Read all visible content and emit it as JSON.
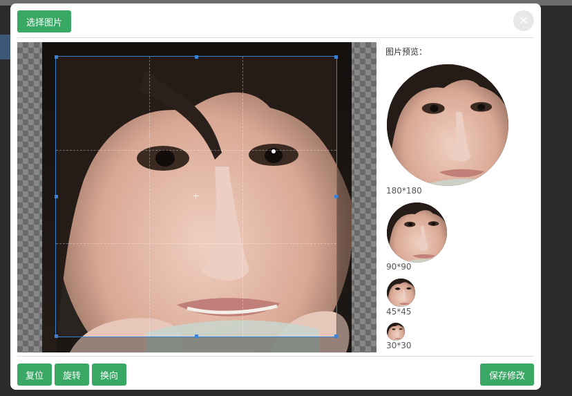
{
  "header": {
    "select_image_label": "选择图片",
    "close_icon": "close-icon"
  },
  "preview": {
    "label": "图片预览：",
    "sizes": [
      {
        "caption": "180*180"
      },
      {
        "caption": "90*90"
      },
      {
        "caption": "45*45"
      },
      {
        "caption": "30*30"
      }
    ]
  },
  "footer": {
    "reset_label": "复位",
    "rotate_label": "旋转",
    "flip_label": "换向",
    "save_label": "保存修改"
  },
  "colors": {
    "accent": "#3aa865",
    "crop_outline": "#3b82d6"
  }
}
